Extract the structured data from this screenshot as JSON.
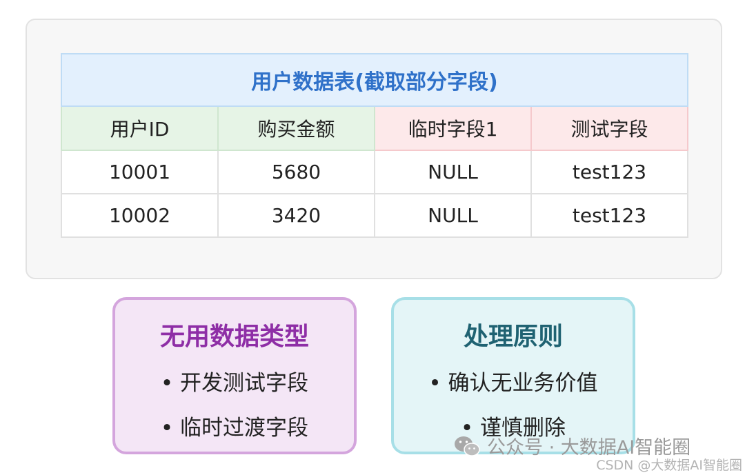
{
  "table": {
    "title": "用户数据表(截取部分字段)",
    "headers": [
      "用户ID",
      "购买金额",
      "临时字段1",
      "测试字段"
    ],
    "rows": [
      [
        "10001",
        "5680",
        "NULL",
        "test123"
      ],
      [
        "10002",
        "3420",
        "NULL",
        "test123"
      ]
    ],
    "colors": {
      "title_text": "#2f71c9",
      "title_bg": "#e3f0fd",
      "header_green": "#e6f4e6",
      "header_red": "#fde9ea"
    }
  },
  "cards": {
    "useless_types": {
      "title": "无用数据类型",
      "items": [
        "• 开发测试字段",
        "• 临时过渡字段"
      ],
      "colors": {
        "title": "#8e2ea6",
        "bg": "#f4e6f6",
        "border": "#d4a5dd"
      }
    },
    "principles": {
      "title": "处理原则",
      "items": [
        "• 确认无业务价值",
        "• 谨慎删除"
      ],
      "colors": {
        "title": "#1f6272",
        "bg": "#e4f5f7",
        "border": "#a7dfe7"
      }
    }
  },
  "watermark": {
    "icon": "wechat-icon",
    "text": "公众号 · 大数据AI智能圈"
  },
  "credit": "CSDN @大数据AI智能圈"
}
